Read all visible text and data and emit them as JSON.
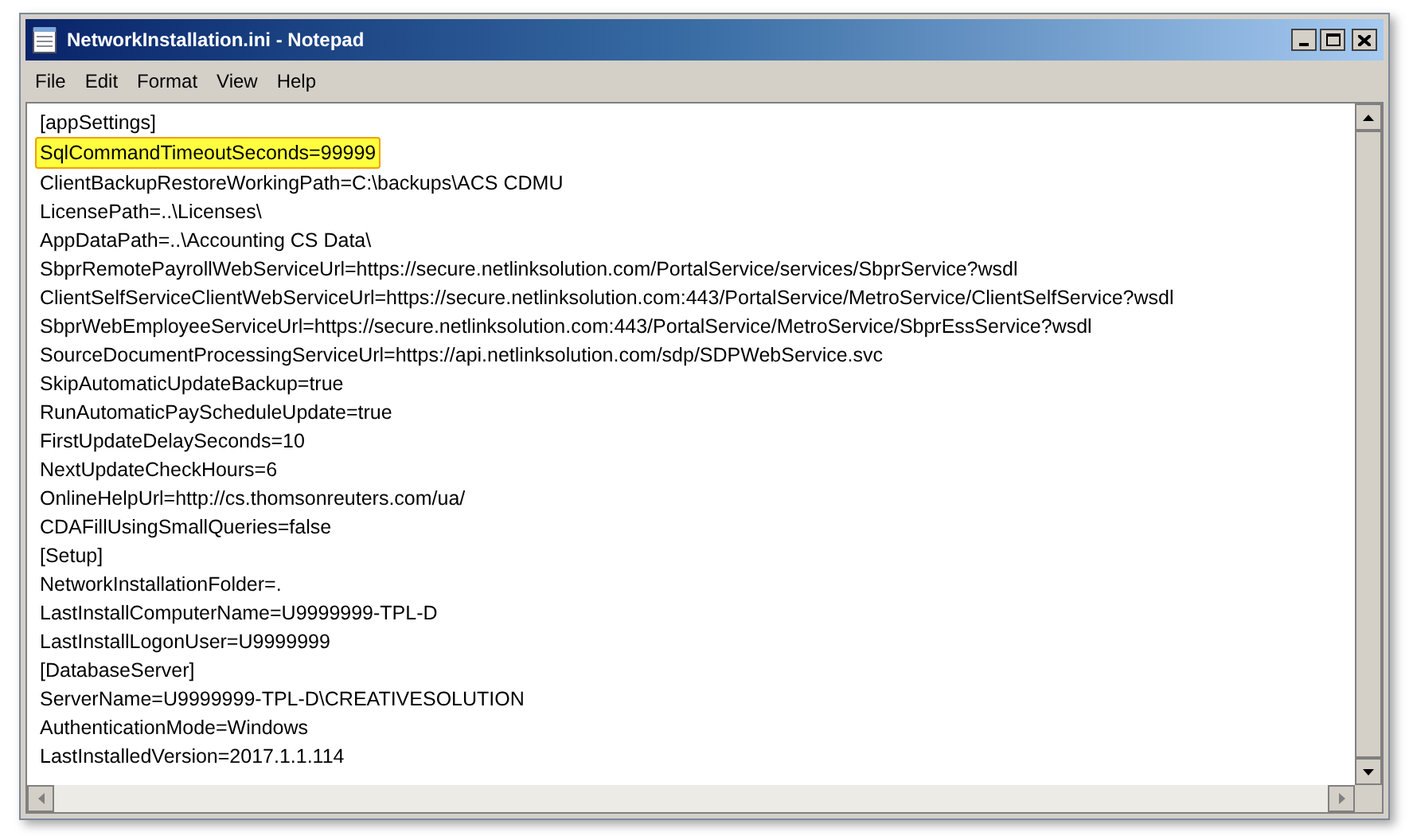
{
  "window": {
    "title": "NetworkInstallation.ini - Notepad"
  },
  "menu": [
    "File",
    "Edit",
    "Format",
    "View",
    "Help"
  ],
  "lines": [
    {
      "text": "[appSettings]",
      "highlighted": false
    },
    {
      "text": "SqlCommandTimeoutSeconds=99999",
      "highlighted": true
    },
    {
      "text": "ClientBackupRestoreWorkingPath=C:\\backups\\ACS CDMU",
      "highlighted": false
    },
    {
      "text": "LicensePath=..\\Licenses\\",
      "highlighted": false
    },
    {
      "text": "AppDataPath=..\\Accounting CS Data\\",
      "highlighted": false
    },
    {
      "text": "SbprRemotePayrollWebServiceUrl=https://secure.netlinksolution.com/PortalService/services/SbprService?wsdl",
      "highlighted": false
    },
    {
      "text": "ClientSelfServiceClientWebServiceUrl=https://secure.netlinksolution.com:443/PortalService/MetroService/ClientSelfService?wsdl",
      "highlighted": false
    },
    {
      "text": "SbprWebEmployeeServiceUrl=https://secure.netlinksolution.com:443/PortalService/MetroService/SbprEssService?wsdl",
      "highlighted": false
    },
    {
      "text": "SourceDocumentProcessingServiceUrl=https://api.netlinksolution.com/sdp/SDPWebService.svc",
      "highlighted": false
    },
    {
      "text": "SkipAutomaticUpdateBackup=true",
      "highlighted": false
    },
    {
      "text": "RunAutomaticPayScheduleUpdate=true",
      "highlighted": false
    },
    {
      "text": "FirstUpdateDelaySeconds=10",
      "highlighted": false
    },
    {
      "text": "NextUpdateCheckHours=6",
      "highlighted": false
    },
    {
      "text": "OnlineHelpUrl=http://cs.thomsonreuters.com/ua/",
      "highlighted": false
    },
    {
      "text": "CDAFillUsingSmallQueries=false",
      "highlighted": false
    },
    {
      "text": "[Setup]",
      "highlighted": false
    },
    {
      "text": "NetworkInstallationFolder=.",
      "highlighted": false
    },
    {
      "text": "LastInstallComputerName=U9999999-TPL-D",
      "highlighted": false
    },
    {
      "text": "LastInstallLogonUser=U9999999",
      "highlighted": false
    },
    {
      "text": "[DatabaseServer]",
      "highlighted": false
    },
    {
      "text": "ServerName=U9999999-TPL-D\\CREATIVESOLUTION",
      "highlighted": false
    },
    {
      "text": "AuthenticationMode=Windows",
      "highlighted": false
    },
    {
      "text": "LastInstalledVersion=2017.1.1.114",
      "highlighted": false
    }
  ]
}
